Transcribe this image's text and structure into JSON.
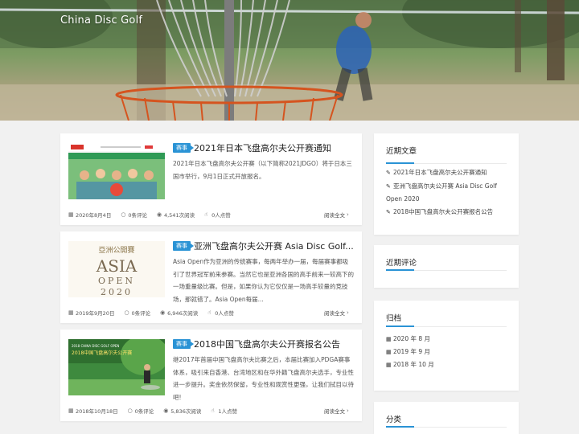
{
  "site": {
    "title": "China Disc Golf"
  },
  "posts": [
    {
      "badge": "赛事",
      "title": "2021年日本飞盘高尔夫公开赛通知",
      "excerpt": "2021年日本飞盘高尔夫公开赛（以下简称2021JDGO）将于日本三国市举行，9月1日正式开放报名。",
      "date": "2020年8月4日",
      "comments": "0条评论",
      "views": "4,541次阅读",
      "likes": "0人点赞",
      "readmore": "阅读全文"
    },
    {
      "badge": "赛事",
      "title": "亚洲飞盘高尔夫公开赛 Asia Disc Golf...",
      "excerpt": "Asia Open作为亚洲的传统赛事，每两年举办一届，每届赛事都吸引了世界冠军前来参赛。当然它也是亚洲各国的高手前来一较高下的一场重量级比赛。但是，如果你认为它仅仅是一场高手较量的竞技场，那就错了。Asia Open每届...",
      "date": "2019年9月20日",
      "comments": "0条评论",
      "views": "6,946次阅读",
      "likes": "0人点赞",
      "readmore": "阅读全文",
      "thumb_text": {
        "top": "亞洲公開賽",
        "mid": "ASIA",
        "bottom": "OPEN",
        "year": "2020"
      }
    },
    {
      "badge": "赛事",
      "title": "2018中国飞盘高尔夫公开赛报名公告",
      "excerpt": "继2017年首届中国飞盘高尔夫比赛之后，本届比赛加入PDGA赛事体系，吸引来自香港、台湾地区和在华外籍飞盘高尔夫选手，专业性进一步提升。奖金依然保留，专业性和观赏性更强，让我们拭目以待吧!",
      "date": "2018年10月18日",
      "comments": "0条评论",
      "views": "5,836次阅读",
      "likes": "1人点赞",
      "readmore": "阅读全文",
      "thumb_text": {
        "line1": "2018 CHINA DISC GOLF OPEN",
        "line2": "2018中国飞盘高尔夫公开赛"
      }
    }
  ],
  "sidebar": {
    "recent_posts": {
      "title": "近期文章",
      "items": [
        "2021年日本飞盘高尔夫公开赛通知",
        "亚洲飞盘高尔夫公开赛 Asia Disc Golf Open 2020",
        "2018中国飞盘高尔夫公开赛报名公告"
      ]
    },
    "recent_comments": {
      "title": "近期评论"
    },
    "archives": {
      "title": "归档",
      "items": [
        "2020 年 8 月",
        "2019 年 9 月",
        "2018 年 10 月"
      ]
    },
    "categories": {
      "title": "分类"
    }
  },
  "colors": {
    "accent": "#2a93d5",
    "background": "#f1f1f1"
  }
}
